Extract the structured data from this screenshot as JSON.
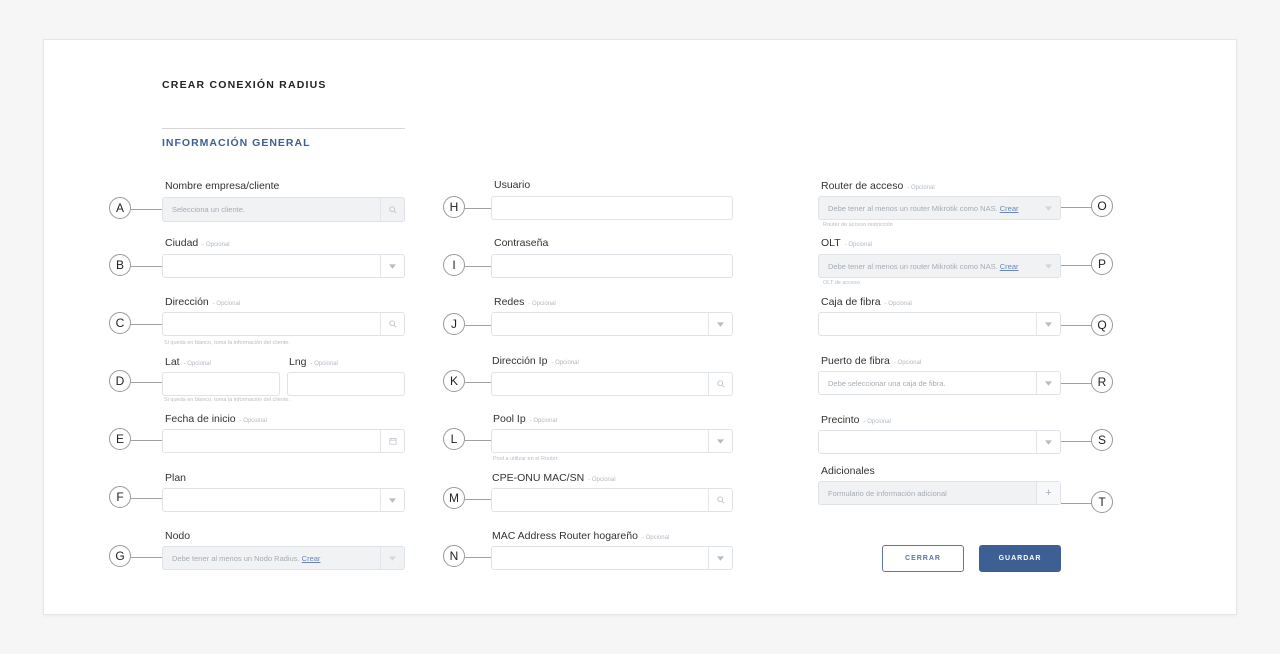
{
  "header": {
    "title": "CREAR CONEXIÓN RADIUS",
    "section_title": "INFORMACIÓN GENERAL"
  },
  "optional_tag": "- Opcional",
  "fields": {
    "client": {
      "label": "Nombre empresa/cliente",
      "placeholder": "Selecciona un cliente."
    },
    "city": {
      "label": "Ciudad"
    },
    "address": {
      "label": "Dirección",
      "help": "Si queda en blanco, toma la información del cliente."
    },
    "lat": {
      "label": "Lat"
    },
    "lng": {
      "label": "Lng",
      "help": "Si queda en blanco, toma la información del cliente."
    },
    "start_date": {
      "label": "Fecha de inicio"
    },
    "plan": {
      "label": "Plan"
    },
    "node": {
      "label": "Nodo",
      "placeholder": "Debe tener al menos un Nodo Radius.",
      "link": "Crear"
    },
    "user": {
      "label": "Usuario"
    },
    "password": {
      "label": "Contraseña"
    },
    "networks": {
      "label": "Redes"
    },
    "ip": {
      "label": "Dirección Ip"
    },
    "pool": {
      "label": "Pool Ip",
      "help": "Pool a utilizar en el Router"
    },
    "cpe": {
      "label": "CPE-ONU MAC/SN"
    },
    "mac_router": {
      "label": "MAC Address Router hogareño"
    },
    "router": {
      "label": "Router de acceso",
      "placeholder": "Debe tener al menos un router Mikrotik como NAS.",
      "link": "Crear",
      "help": "Router de acceso restricción"
    },
    "olt": {
      "label": "OLT",
      "placeholder": "Debe tener al menos un router Mikrotik como NAS.",
      "link": "Crear",
      "help": "OLT de acceso"
    },
    "fiber_box": {
      "label": "Caja de fibra"
    },
    "fiber_port": {
      "label": "Puerto de fibra",
      "placeholder": "Debe seleccionar una caja de fibra."
    },
    "seal": {
      "label": "Precinto"
    },
    "additional": {
      "label": "Adicionales",
      "placeholder": "Formulario de información adicional"
    }
  },
  "callouts": [
    "A",
    "B",
    "C",
    "D",
    "E",
    "F",
    "G",
    "H",
    "I",
    "J",
    "K",
    "L",
    "M",
    "N",
    "O",
    "P",
    "Q",
    "R",
    "S",
    "T"
  ],
  "buttons": {
    "close": "CERRAR",
    "save": "GUARDAR"
  },
  "colors": {
    "accent": "#3e5f93",
    "section_title": "#3d5f91",
    "field_border": "#dfe2e6",
    "disabled_bg": "#f1f2f4"
  }
}
